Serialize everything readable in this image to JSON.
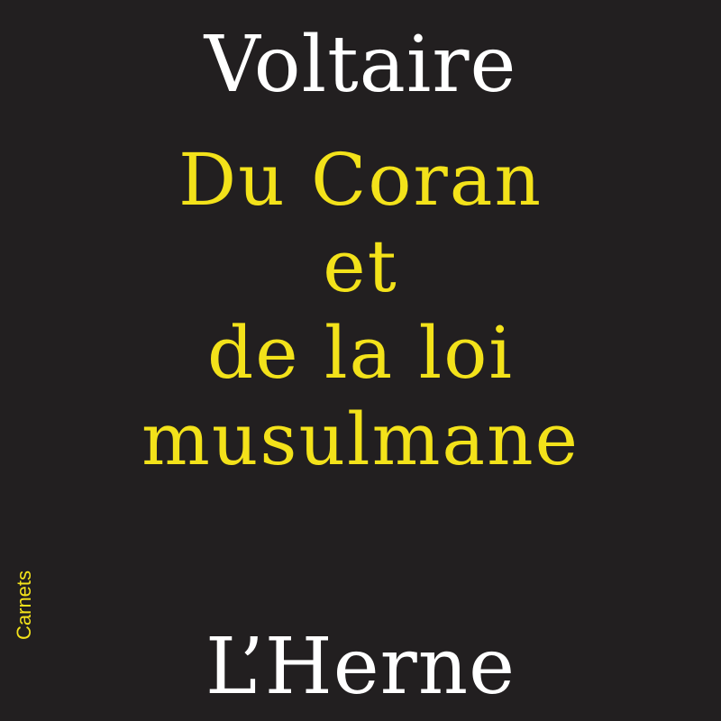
{
  "cover": {
    "author": "Voltaire",
    "title_lines": [
      "Du Coran",
      "et",
      "de la loi",
      "musulmane"
    ],
    "collection": "Carnets",
    "publisher": "L’Herne",
    "colors": {
      "background": "#221f20",
      "title": "#f3e21a",
      "author": "#ffffff",
      "publisher": "#ffffff"
    }
  }
}
